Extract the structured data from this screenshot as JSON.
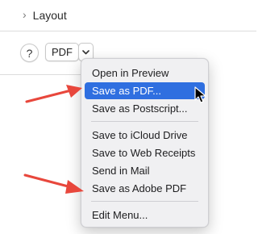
{
  "panel": {
    "layout_label": "Layout",
    "help_label": "?",
    "pdf_button_label": "PDF"
  },
  "menu": {
    "items": [
      {
        "label": "Open in Preview",
        "selected": false
      },
      {
        "label": "Save as PDF...",
        "selected": true
      },
      {
        "label": "Save as Postscript...",
        "selected": false
      },
      {
        "label": "Save to iCloud Drive",
        "selected": false
      },
      {
        "label": "Save to Web Receipts",
        "selected": false
      },
      {
        "label": "Send in Mail",
        "selected": false
      },
      {
        "label": "Save as Adobe PDF",
        "selected": false
      },
      {
        "label": "Edit Menu...",
        "selected": false
      }
    ]
  },
  "colors": {
    "accent": "#2f6fe0",
    "annotation_arrow": "#e8473c"
  }
}
